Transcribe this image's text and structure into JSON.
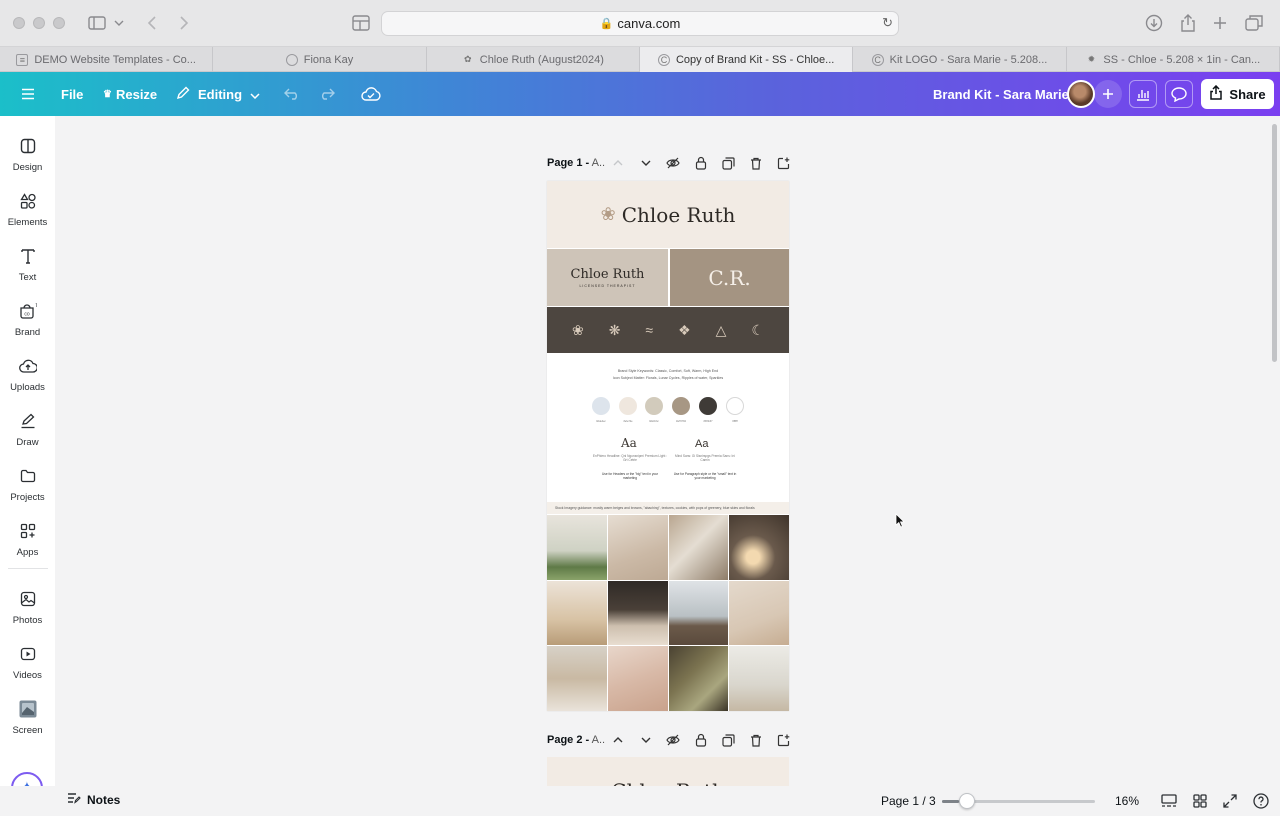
{
  "browser": {
    "url": "canva.com",
    "tabs": [
      {
        "label": "DEMO Website Templates - Co...",
        "active": false
      },
      {
        "label": "Fiona Kay",
        "active": false
      },
      {
        "label": "Chloe Ruth (August2024)",
        "active": false
      },
      {
        "label": "Copy of Brand Kit - SS - Chloe...",
        "active": true
      },
      {
        "label": "Kit LOGO - Sara Marie - 5.208...",
        "active": false
      },
      {
        "label": "SS - Chloe - 5.208 × 1in - Can...",
        "active": false
      }
    ]
  },
  "header": {
    "file": "File",
    "resize": "Resize",
    "editing": "Editing",
    "doc_title": "Brand Kit - Sara Marie",
    "share": "Share"
  },
  "sidebar": {
    "items": [
      {
        "label": "Design",
        "icon": "design-icon"
      },
      {
        "label": "Elements",
        "icon": "elements-icon"
      },
      {
        "label": "Text",
        "icon": "text-icon"
      },
      {
        "label": "Brand",
        "icon": "brand-icon"
      },
      {
        "label": "Uploads",
        "icon": "uploads-icon"
      },
      {
        "label": "Draw",
        "icon": "draw-icon"
      },
      {
        "label": "Projects",
        "icon": "projects-icon"
      },
      {
        "label": "Apps",
        "icon": "apps-icon"
      },
      {
        "label": "Photos",
        "icon": "photos-icon"
      },
      {
        "label": "Videos",
        "icon": "videos-icon"
      },
      {
        "label": "Screen",
        "icon": "screen-icon"
      }
    ]
  },
  "pages": [
    {
      "label": "Page 1 -",
      "suffix": "A.."
    },
    {
      "label": "Page 2 -",
      "suffix": "A.."
    }
  ],
  "design": {
    "brand_name": "Chloe Ruth",
    "sub_logo": "Chloe Ruth",
    "sub_logo_tagline": "LICENSED THERAPIST",
    "monogram": "C.R.",
    "keywords_line1": "Brand Style Keywords: Classic, Comfort, Soft, Warm, High End",
    "keywords_line2": "Icon Subject Matter: Florals, Lunar Cycles, Ripples of water, Sparkles",
    "swatches": [
      "#dde4ec",
      "#efe7de",
      "#d2cbbc",
      "#a79784",
      "#3f3b37",
      "#ffffff"
    ],
    "swatch_labels": [
      "#dde4ec",
      "#efe7de",
      "#d2cbbc",
      "#a79784",
      "#3f3b37",
      "#ffffff"
    ],
    "font_sample": "Aa",
    "font1_desc": "EnPhiero Headline: Qni Ngunsnipmi Premium Light : Grt Cetrie",
    "font2_desc": "Mind Sans: Gi Sisnirspgs Premia Sans: Ini Camin",
    "font1_use": "Use for Headers or the \"big\" text in your marketing",
    "font2_use": "Use for Paragraph style or the \"small\" text in your marketing",
    "imagery_note": "Stock Imagery guidance: mostly warm beiges and browns, \"abaching\", textures, cookies, with pops of greenery, blue skies and florals",
    "page2_title": "Chloe Ruth"
  },
  "bottom": {
    "notes": "Notes",
    "page_count": "Page 1 / 3",
    "zoom": "16%",
    "zoom_fraction": 0.11
  }
}
